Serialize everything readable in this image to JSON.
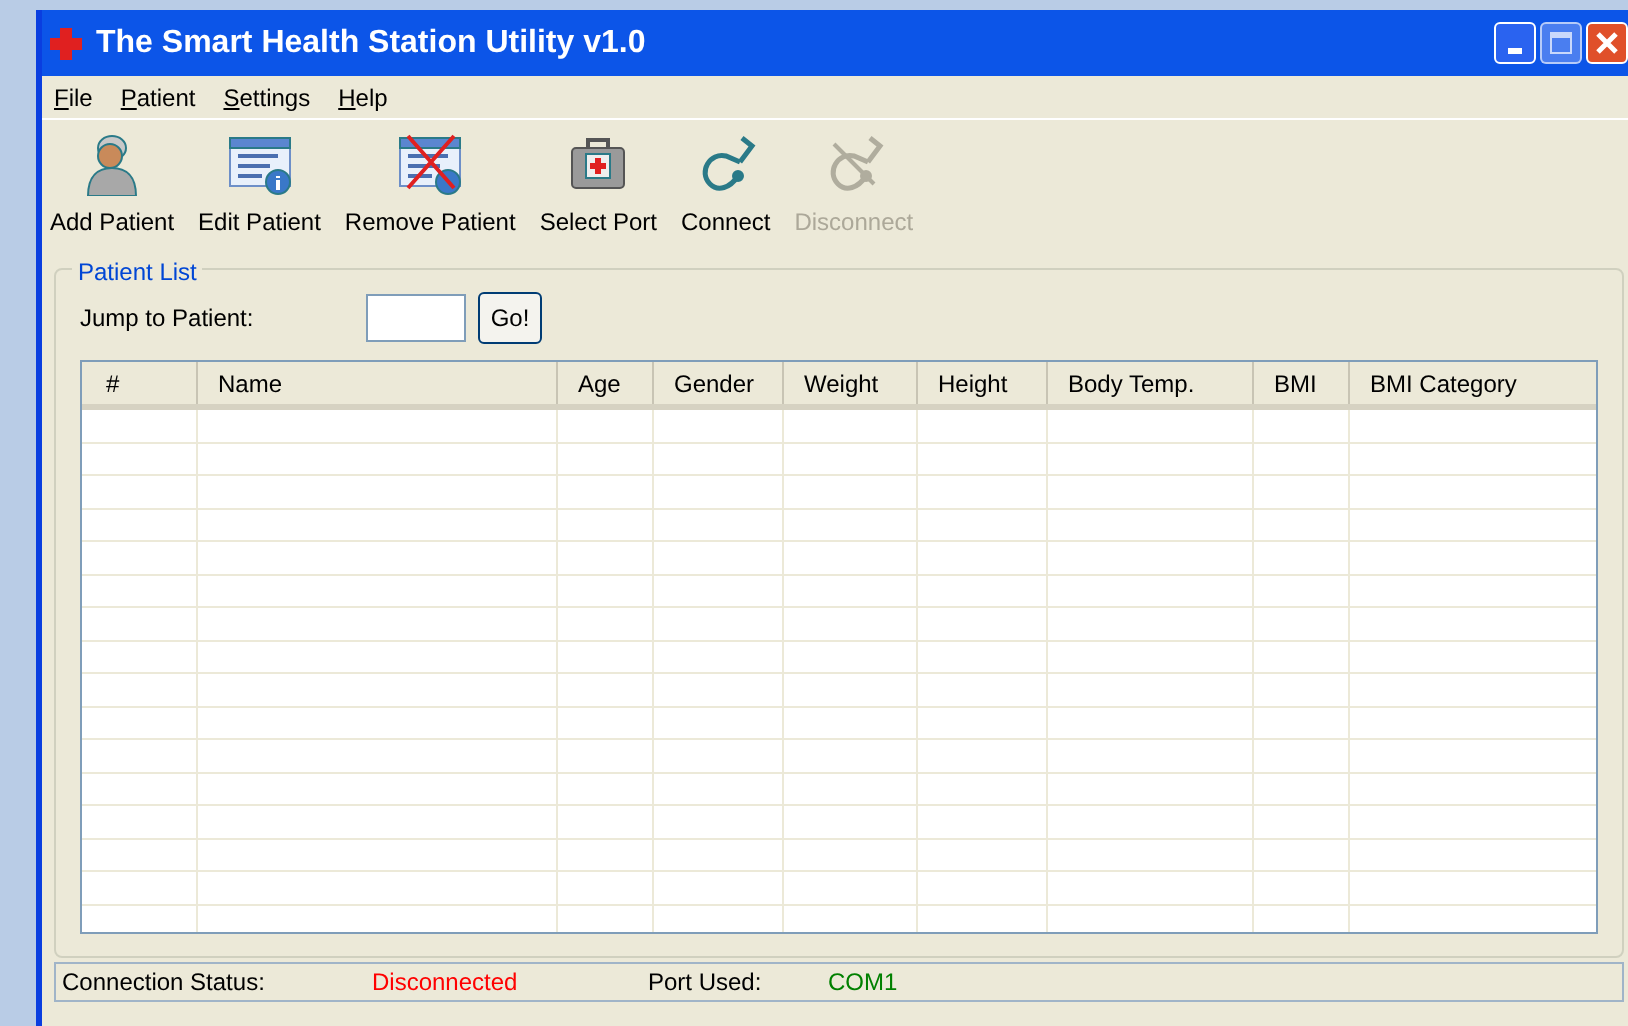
{
  "window": {
    "title": "The Smart Health Station Utility v1.0"
  },
  "menu": [
    {
      "label": "File",
      "mnemonic_underlined": true
    },
    {
      "label": "Patient",
      "mnemonic_underlined": true
    },
    {
      "label": "Settings",
      "mnemonic_underlined": true
    },
    {
      "label": "Help",
      "mnemonic_underlined": true
    }
  ],
  "toolbar": [
    {
      "kind": "person",
      "label": "Add Patient",
      "disabled": false
    },
    {
      "kind": "card",
      "label": "Edit Patient",
      "disabled": false
    },
    {
      "kind": "card-x",
      "label": "Remove Patient",
      "disabled": false
    },
    {
      "kind": "kit",
      "label": "Select Port",
      "disabled": false
    },
    {
      "kind": "stetho",
      "label": "Connect",
      "disabled": false
    },
    {
      "kind": "stetho",
      "label": "Disconnect",
      "disabled": true
    }
  ],
  "patient_list": {
    "title": "Patient List",
    "jump_label": "Jump to Patient:",
    "go_button": "Go!",
    "table": {
      "columns": [
        "#",
        "Name",
        "Age",
        "Gender",
        "Weight",
        "Height",
        "Body Temp.",
        "BMI",
        "BMI Category"
      ]
    }
  },
  "status_bar": {
    "fields": [
      {
        "label": "Connection Status:",
        "value": "Disconnected",
        "color": "#ff0000"
      },
      {
        "label": "Port Used:",
        "value": "COM1",
        "color": "#008000"
      }
    ]
  }
}
